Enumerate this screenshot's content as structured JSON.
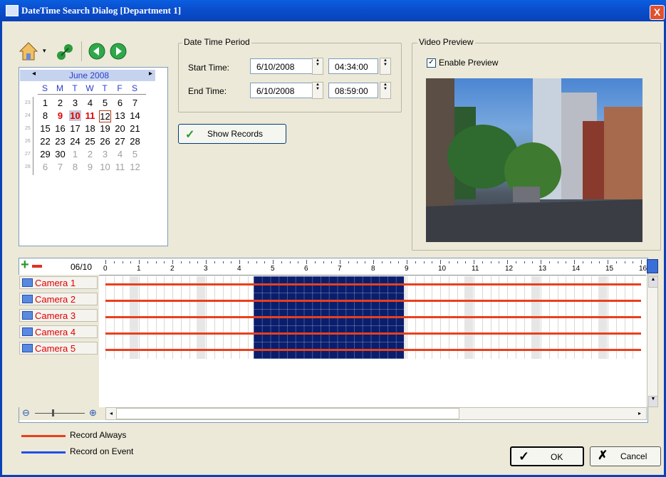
{
  "window": {
    "title": "DateTime Search Dialog  [Department 1]",
    "close_glyph": "X"
  },
  "toolbar": {
    "icons": [
      "home-icon",
      "dropdown-arrow-icon",
      "network-icon",
      "previous-icon",
      "next-icon"
    ]
  },
  "calendar": {
    "month_label": "June 2008",
    "prev_glyph": "◂",
    "next_glyph": "▸",
    "days_of_week": [
      "S",
      "M",
      "T",
      "W",
      "T",
      "F",
      "S"
    ],
    "weeks": [
      {
        "week": "23",
        "days": [
          "1",
          "2",
          "3",
          "4",
          "5",
          "6",
          "7"
        ]
      },
      {
        "week": "24",
        "days": [
          "8",
          "9",
          "10",
          "11",
          "12",
          "13",
          "14"
        ]
      },
      {
        "week": "25",
        "days": [
          "15",
          "16",
          "17",
          "18",
          "19",
          "20",
          "21"
        ]
      },
      {
        "week": "26",
        "days": [
          "22",
          "23",
          "24",
          "25",
          "26",
          "27",
          "28"
        ]
      },
      {
        "week": "27",
        "days": [
          "29",
          "30",
          "1",
          "2",
          "3",
          "4",
          "5"
        ]
      },
      {
        "week": "28",
        "days": [
          "6",
          "7",
          "8",
          "9",
          "10",
          "11",
          "12"
        ]
      }
    ],
    "highlighted_days": [
      "9",
      "10",
      "11"
    ],
    "today": "12"
  },
  "date_time_period": {
    "legend": "Date Time Period",
    "start_label": "Start Time:",
    "start_date": "6/10/2008",
    "start_time": "04:34:00",
    "end_label": "End Time:",
    "end_date": "6/10/2008",
    "end_time": "08:59:00"
  },
  "show_records": {
    "label": "Show Records",
    "check_glyph": "✓"
  },
  "video_preview": {
    "legend": "Video Preview",
    "enable_label": "Enable Preview",
    "enabled": true
  },
  "timeline": {
    "date_label": "06/10",
    "hours": [
      "0",
      "1",
      "2",
      "3",
      "4",
      "5",
      "6",
      "7",
      "8",
      "9",
      "10",
      "11",
      "12",
      "13",
      "14",
      "15",
      "16"
    ],
    "selection_start_hour": 4.5,
    "selection_end_hour": 9.0,
    "cameras": [
      "Camera 1",
      "Camera 2",
      "Camera 3",
      "Camera 4",
      "Camera 5"
    ]
  },
  "legend": {
    "record_always": {
      "label": "Record Always",
      "color": "#e8401c"
    },
    "record_on_event": {
      "label": "Record on Event",
      "color": "#1f4fe6"
    }
  },
  "buttons": {
    "ok": {
      "label": "OK",
      "glyph": "✓"
    },
    "cancel": {
      "label": "Cancel",
      "glyph": "✗"
    }
  },
  "colors": {
    "selection": "#0a1e6e",
    "title_bar": "#0a4fd0",
    "camera_text": "#e00000"
  }
}
